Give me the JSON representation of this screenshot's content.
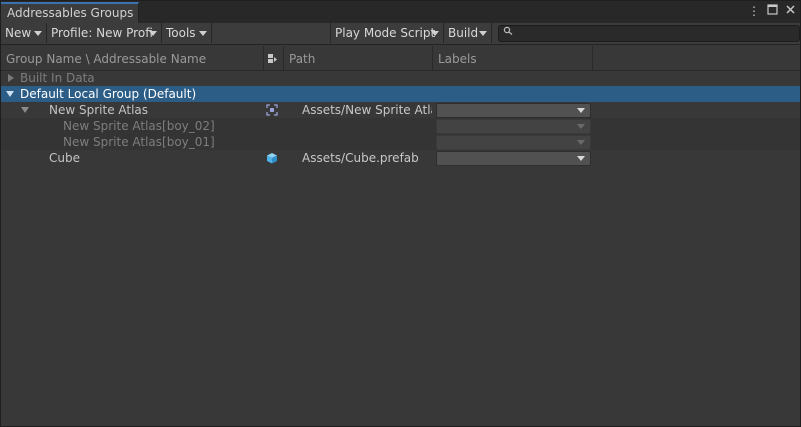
{
  "window": {
    "tab_title": "Addressables Groups",
    "icons": [
      "more-options-icon",
      "maximize-icon",
      "close-icon"
    ]
  },
  "toolbar": {
    "new_label": "New",
    "profile_label": "Profile: New Profi",
    "tools_label": "Tools",
    "play_mode_label": "Play Mode Script",
    "build_label": "Build",
    "search_value": "",
    "search_icon": "search-icon"
  },
  "columns": {
    "name": "Group Name \\ Addressable Name",
    "path": "Path",
    "labels": "Labels"
  },
  "rows": [
    {
      "name": "Built In Data",
      "path": "",
      "fold": "collapsed"
    },
    {
      "name": "Default Local Group (Default)",
      "path": "",
      "fold": "expanded",
      "selected": true
    },
    {
      "name": "New Sprite Atlas",
      "path": "Assets/New Sprite Atla",
      "fold": "expanded",
      "icon": "sprite-atlas-icon"
    },
    {
      "name": "New Sprite Atlas[boy_02]",
      "path": ""
    },
    {
      "name": "New Sprite Atlas[boy_01]",
      "path": ""
    },
    {
      "name": "Cube",
      "path": "Assets/Cube.prefab",
      "icon": "prefab-cube-icon"
    }
  ],
  "colors": {
    "selection": "#2c5d87",
    "tab_accent": "#3a72b0",
    "prefab_icon": "#4fb3e8",
    "atlas_icon": "#9aa0d8"
  }
}
